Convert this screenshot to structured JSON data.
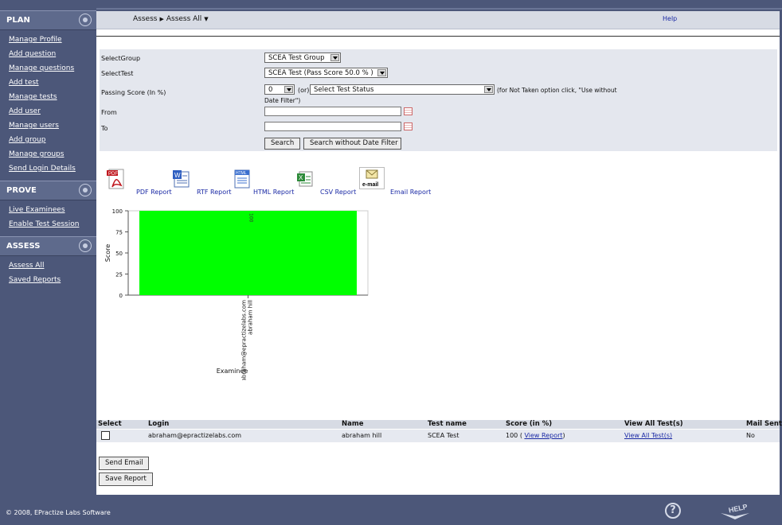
{
  "sidebar": {
    "sections": [
      {
        "title": "PLAN",
        "icon": "target-icon",
        "items": [
          "Manage Profile",
          "Add question",
          "Manage questions",
          "Add test",
          "Manage tests",
          "Add user",
          "Manage users",
          "Add group",
          "Manage groups",
          "Send Login Details"
        ]
      },
      {
        "title": "PROVE",
        "icon": "target-icon",
        "items": [
          "Live Examinees",
          "Enable Test Session"
        ]
      },
      {
        "title": "ASSESS",
        "icon": "crosshair-icon",
        "items": [
          "Assess All",
          "Saved Reports"
        ]
      }
    ]
  },
  "header": {
    "breadcrumb_root": "Assess",
    "breadcrumb_current": "Assess All",
    "help": "Help"
  },
  "filter": {
    "select_group_label": "SelectGroup",
    "select_group_value": "SCEA Test Group",
    "select_test_label": "SelectTest",
    "select_test_value": "SCEA Test (Pass Score 50.0 % )",
    "passing_score_label": "Passing Score (In %)",
    "passing_score_value": "0",
    "or_text": "(or)",
    "test_status_value": "Select Test Status",
    "note": "(for Not Taken option click, \"Use without",
    "note2": "Date Filter\")",
    "from_label": "From",
    "to_label": "To",
    "search_button": "Search",
    "search_nodate_button": "Search without Date Filter"
  },
  "reports": {
    "pdf": "PDF Report",
    "rtf": "RTF Report",
    "html": "HTML Report",
    "csv": "CSV Report",
    "email": "Email Report",
    "pdf_icon_text": "PDF",
    "html_icon_text": "HTML",
    "email_icon_text": "e-mail"
  },
  "chart_data": {
    "type": "bar",
    "categories": [
      "abraham@epractizelabs.com\nabraham hill"
    ],
    "values": [
      100
    ],
    "data_labels": [
      "100"
    ],
    "xlabel": "Examinee",
    "ylabel": "Score",
    "ylim": [
      0,
      100
    ],
    "yticks": [
      0,
      25,
      50,
      75,
      100
    ],
    "grid": false,
    "bar_color": "#00ff00"
  },
  "table": {
    "headers": [
      "Select",
      "Login",
      "Name",
      "Test name",
      "Score (in %)",
      "View All Test(s)",
      "Mail Sent"
    ],
    "rows": [
      {
        "login": "abraham@epractizelabs.com",
        "name": "abraham hill",
        "test": "SCEA Test",
        "score": "100 ( ",
        "view_report": "View Report",
        "score_close": ")",
        "view_all": "View All Test(s)",
        "mail_sent": "No"
      }
    ]
  },
  "actions": {
    "send_email": "Send Email",
    "save_report": "Save Report"
  },
  "footer": {
    "copyright": "© 2008, EPractize Labs Software",
    "help_icon_text": "HELP"
  },
  "colors": {
    "sidebar_bg": "#4c5779",
    "link": "#1b2aa5",
    "bar": "#00ff00",
    "panel": "#e4e7ee"
  }
}
